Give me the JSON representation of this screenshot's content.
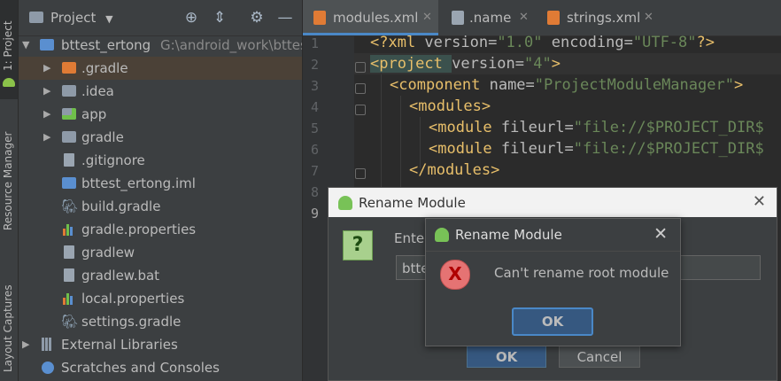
{
  "toolstrip": {
    "project_tab": "1: Project",
    "resource_manager": "Resource Manager",
    "layout_captures": "Layout Captures"
  },
  "panel": {
    "title": "Project",
    "dropdown_icon": "chevron-down-icon",
    "header_icons": [
      "target-icon",
      "collapse-icon",
      "gear-icon",
      "minimize-icon"
    ]
  },
  "tree": {
    "root_name": "bttest_ertong",
    "root_path": "G:\\android_work\\bttes",
    "items": [
      {
        "label": ".gradle",
        "icon": "folder-icon"
      },
      {
        "label": ".idea",
        "icon": "folder-icon"
      },
      {
        "label": "app",
        "icon": "module-folder-icon"
      },
      {
        "label": "gradle",
        "icon": "folder-icon"
      },
      {
        "label": ".gitignore",
        "icon": "file-icon"
      },
      {
        "label": "bttest_ertong.iml",
        "icon": "module-file-icon"
      },
      {
        "label": "build.gradle",
        "icon": "gradle-icon"
      },
      {
        "label": "gradle.properties",
        "icon": "properties-icon"
      },
      {
        "label": "gradlew",
        "icon": "file-icon"
      },
      {
        "label": "gradlew.bat",
        "icon": "file-icon"
      },
      {
        "label": "local.properties",
        "icon": "properties-icon"
      },
      {
        "label": "settings.gradle",
        "icon": "gradle-icon"
      }
    ],
    "external_libraries": "External Libraries",
    "scratches": "Scratches and Consoles"
  },
  "tabs": [
    {
      "label": "modules.xml",
      "active": true
    },
    {
      "label": ".name",
      "active": false
    },
    {
      "label": "strings.xml",
      "active": false
    }
  ],
  "editor": {
    "line_numbers": [
      "1",
      "2",
      "3",
      "4",
      "5",
      "6",
      "7",
      "8",
      "9"
    ],
    "lines": {
      "l1": {
        "a": "<?xml ",
        "b": "version=",
        "c": "\"1.0\" ",
        "d": "encoding=",
        "e": "\"UTF-8\"",
        "f": "?>"
      },
      "l2": {
        "a": "<project ",
        "b": "version=",
        "c": "\"4\"",
        "d": ">"
      },
      "l3": {
        "a": "<component ",
        "b": "name=",
        "c": "\"ProjectModuleManager\"",
        "d": ">"
      },
      "l4": {
        "a": "<modules>"
      },
      "l5": {
        "a": "<module ",
        "b": "fileurl=",
        "c": "\"file://$PROJECT_DIR$"
      },
      "l6": {
        "a": "<module ",
        "b": "fileurl=",
        "c": "\"file://$PROJECT_DIR$"
      },
      "l7": {
        "a": "</modules>"
      }
    }
  },
  "dialog_rename": {
    "title": "Rename Module",
    "prompt": "Ente",
    "input_value": "btte",
    "ok": "OK",
    "cancel": "Cancel",
    "question_glyph": "?"
  },
  "dialog_error": {
    "title": "Rename Module",
    "message": "Can't rename root module",
    "ok": "OK",
    "error_glyph": "X"
  },
  "colors": {
    "accent": "#4a88c7",
    "selection": "#4b4137",
    "tag": "#e8bf6a",
    "string": "#6a8759"
  }
}
